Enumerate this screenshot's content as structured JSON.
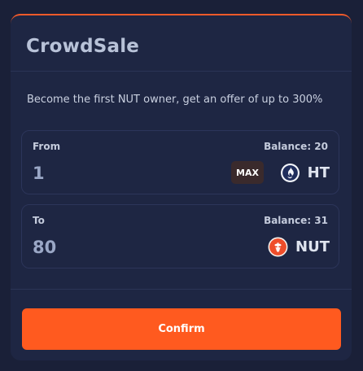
{
  "card": {
    "title": "CrowdSale",
    "subtitle": "Become the first NUT owner, get an offer of up to 300%"
  },
  "from": {
    "label": "From",
    "balance": "Balance: 20",
    "amount": "1",
    "max_label": "MAX",
    "token_symbol": "HT",
    "token_icon": "ht-flame-icon"
  },
  "to": {
    "label": "To",
    "balance": "Balance: 31",
    "amount": "80",
    "token_symbol": "NUT",
    "token_icon": "nut-token-icon"
  },
  "confirm": {
    "label": "Confirm"
  },
  "colors": {
    "background": "#1a2038",
    "card": "#1e2643",
    "accent": "#ff5a1f",
    "text_muted": "#9aa7c6"
  }
}
